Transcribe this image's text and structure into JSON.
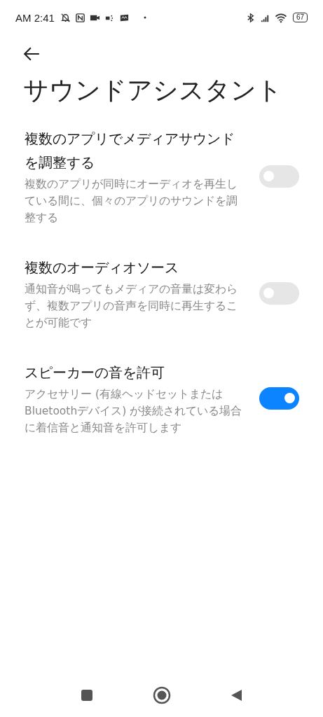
{
  "status_bar": {
    "time": "AM 2:41",
    "battery": "67"
  },
  "title": "サウンドアシスタント",
  "settings": [
    {
      "title": "複数のアプリでメディアサウンドを調整する",
      "description": "複数のアプリが同時にオーディオを再生している間に、個々のアプリのサウンドを調整する",
      "on": false
    },
    {
      "title": "複数のオーディオソース",
      "description": "通知音が鳴ってもメディアの音量は変わらず、複数アプリの音声を同時に再生することが可能です",
      "on": false
    },
    {
      "title": "スピーカーの音を許可",
      "description": "アクセサリー (有線ヘッドセットまたはBluetoothデバイス) が接続されている場合に着信音と通知音を許可します",
      "on": true
    }
  ]
}
